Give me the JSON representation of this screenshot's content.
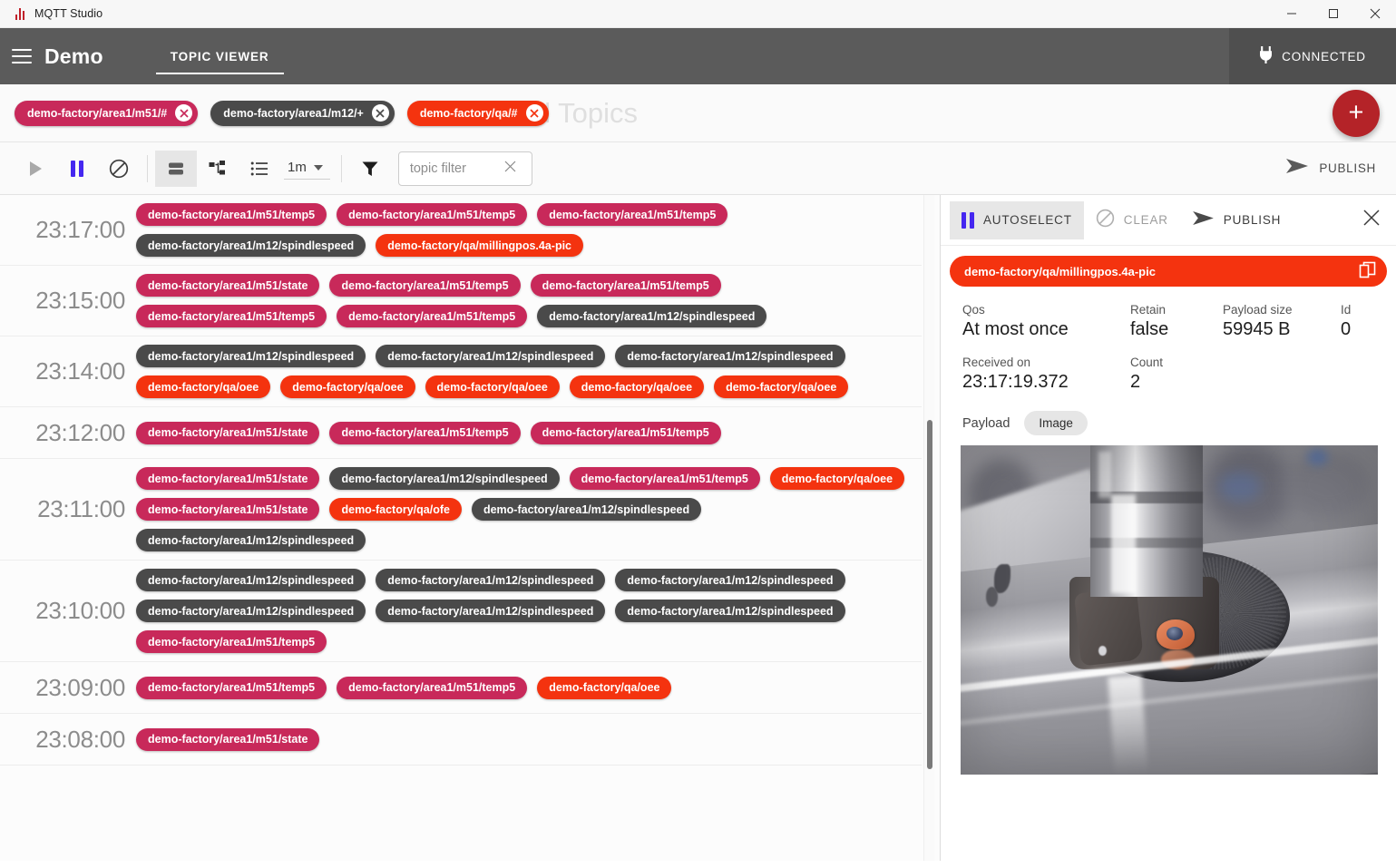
{
  "window": {
    "title": "MQTT Studio",
    "logo_icon": "mqtt-bars-logo",
    "minimize_icon": "minimize-icon",
    "maximize_icon": "maximize-icon",
    "close_icon": "close-icon"
  },
  "header": {
    "menu_icon": "hamburger-menu-icon",
    "app_title": "Demo",
    "tabs": [
      {
        "label": "TOPIC VIEWER",
        "selected": true
      }
    ],
    "connection": {
      "label": "CONNECTED",
      "icon": "power-plug-icon"
    }
  },
  "subscriptions": {
    "watermark": "Subscribed Topics",
    "add_button_label": "+",
    "chips": [
      {
        "label": "demo-factory/area1/m51/#",
        "color": "#c8295a",
        "close_icon": "close-icon"
      },
      {
        "label": "demo-factory/area1/m12/+",
        "color": "#4a4a4a",
        "close_icon": "close-icon"
      },
      {
        "label": "demo-factory/qa/#",
        "color": "#f4330f",
        "close_icon": "close-icon"
      }
    ]
  },
  "toolbar": {
    "play_icon": "play-icon",
    "pause_icon": "pause-icon",
    "stop_icon": "block-clear-icon",
    "view_modes": [
      {
        "icon": "stacked-rows-view-icon",
        "selected": true
      },
      {
        "icon": "tree-view-icon",
        "selected": false
      },
      {
        "icon": "list-view-icon",
        "selected": false
      }
    ],
    "time_range": "1m",
    "time_caret_icon": "chevron-down-icon",
    "filter_icon": "funnel-filter-icon",
    "topic_filter_value": "",
    "topic_filter_placeholder": "topic filter",
    "topic_filter_clear_icon": "close-icon",
    "publish_label": "PUBLISH",
    "publish_icon": "send-icon"
  },
  "messages": {
    "colors": {
      "crimson": "#c8295a",
      "dark": "#4a4a4a",
      "orange": "#f4330f"
    },
    "rows": [
      {
        "time": "23:17:00",
        "topics": [
          {
            "label": "demo-factory/area1/m51/temp5",
            "color": "#c8295a"
          },
          {
            "label": "demo-factory/area1/m51/temp5",
            "color": "#c8295a"
          },
          {
            "label": "demo-factory/area1/m51/temp5",
            "color": "#c8295a"
          },
          {
            "label": "demo-factory/area1/m12/spindlespeed",
            "color": "#4a4a4a"
          },
          {
            "label": "demo-factory/qa/millingpos.4a-pic",
            "color": "#f4330f"
          }
        ]
      },
      {
        "time": "23:15:00",
        "topics": [
          {
            "label": "demo-factory/area1/m51/state",
            "color": "#c8295a"
          },
          {
            "label": "demo-factory/area1/m51/temp5",
            "color": "#c8295a"
          },
          {
            "label": "demo-factory/area1/m51/temp5",
            "color": "#c8295a"
          },
          {
            "label": "demo-factory/area1/m51/temp5",
            "color": "#c8295a"
          },
          {
            "label": "demo-factory/area1/m51/temp5",
            "color": "#c8295a"
          },
          {
            "label": "demo-factory/area1/m12/spindlespeed",
            "color": "#4a4a4a"
          }
        ]
      },
      {
        "time": "23:14:00",
        "topics": [
          {
            "label": "demo-factory/area1/m12/spindlespeed",
            "color": "#4a4a4a"
          },
          {
            "label": "demo-factory/area1/m12/spindlespeed",
            "color": "#4a4a4a"
          },
          {
            "label": "demo-factory/area1/m12/spindlespeed",
            "color": "#4a4a4a"
          },
          {
            "label": "demo-factory/qa/oee",
            "color": "#f4330f"
          },
          {
            "label": "demo-factory/qa/oee",
            "color": "#f4330f"
          },
          {
            "label": "demo-factory/qa/oee",
            "color": "#f4330f"
          },
          {
            "label": "demo-factory/qa/oee",
            "color": "#f4330f"
          },
          {
            "label": "demo-factory/qa/oee",
            "color": "#f4330f"
          }
        ]
      },
      {
        "time": "23:12:00",
        "topics": [
          {
            "label": "demo-factory/area1/m51/state",
            "color": "#c8295a"
          },
          {
            "label": "demo-factory/area1/m51/temp5",
            "color": "#c8295a"
          },
          {
            "label": "demo-factory/area1/m51/temp5",
            "color": "#c8295a"
          }
        ]
      },
      {
        "time": "23:11:00",
        "topics": [
          {
            "label": "demo-factory/area1/m51/state",
            "color": "#c8295a"
          },
          {
            "label": "demo-factory/area1/m12/spindlespeed",
            "color": "#4a4a4a"
          },
          {
            "label": "demo-factory/area1/m51/temp5",
            "color": "#c8295a"
          },
          {
            "label": "demo-factory/qa/oee",
            "color": "#f4330f"
          },
          {
            "label": "demo-factory/area1/m51/state",
            "color": "#c8295a"
          },
          {
            "label": "demo-factory/qa/ofe",
            "color": "#f4330f"
          },
          {
            "label": "demo-factory/area1/m12/spindlespeed",
            "color": "#4a4a4a"
          },
          {
            "label": "demo-factory/area1/m12/spindlespeed",
            "color": "#4a4a4a"
          }
        ]
      },
      {
        "time": "23:10:00",
        "topics": [
          {
            "label": "demo-factory/area1/m12/spindlespeed",
            "color": "#4a4a4a"
          },
          {
            "label": "demo-factory/area1/m12/spindlespeed",
            "color": "#4a4a4a"
          },
          {
            "label": "demo-factory/area1/m12/spindlespeed",
            "color": "#4a4a4a"
          },
          {
            "label": "demo-factory/area1/m12/spindlespeed",
            "color": "#4a4a4a"
          },
          {
            "label": "demo-factory/area1/m12/spindlespeed",
            "color": "#4a4a4a"
          },
          {
            "label": "demo-factory/area1/m12/spindlespeed",
            "color": "#4a4a4a"
          },
          {
            "label": "demo-factory/area1/m51/temp5",
            "color": "#c8295a"
          }
        ]
      },
      {
        "time": "23:09:00",
        "topics": [
          {
            "label": "demo-factory/area1/m51/temp5",
            "color": "#c8295a"
          },
          {
            "label": "demo-factory/area1/m51/temp5",
            "color": "#c8295a"
          },
          {
            "label": "demo-factory/qa/oee",
            "color": "#f4330f"
          }
        ]
      },
      {
        "time": "23:08:00",
        "topics": [
          {
            "label": "demo-factory/area1/m51/state",
            "color": "#c8295a"
          }
        ]
      }
    ]
  },
  "detail": {
    "autoselect_label": "AUTOSELECT",
    "autoselect_icon": "pause-icon",
    "clear_label": "CLEAR",
    "clear_icon": "block-clear-icon",
    "publish_label": "PUBLISH",
    "publish_icon": "send-icon",
    "close_icon": "close-icon",
    "topic": "demo-factory/qa/millingpos.4a-pic",
    "topic_color": "#f4330f",
    "copy_icon": "copy-icon",
    "fields_row1": [
      {
        "key": "Qos",
        "value": "At most once"
      },
      {
        "key": "Retain",
        "value": "false"
      },
      {
        "key": "Payload size",
        "value": "59945 B"
      },
      {
        "key": "Id",
        "value": "0"
      }
    ],
    "fields_row2": [
      {
        "key": "Received on",
        "value": "23:17:19.372"
      },
      {
        "key": "Count",
        "value": "2"
      }
    ],
    "payload_label": "Payload",
    "payload_tab": "Image",
    "payload_image_alt": "cnc-milling-cutter-photo"
  }
}
